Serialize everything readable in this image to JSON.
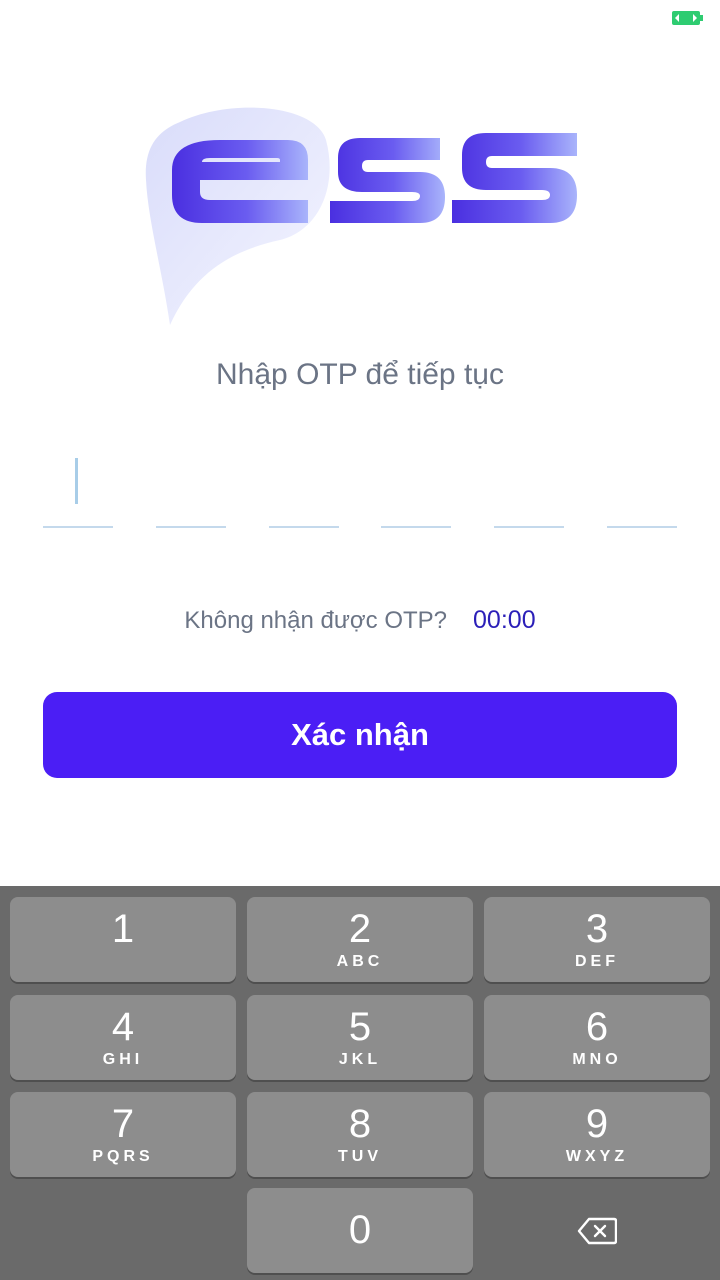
{
  "colors": {
    "accent": "#4b1ef5",
    "timer": "#2b1fb8",
    "muted_text": "#6b7485",
    "keypad_bg": "#6a6a6a",
    "key_bg": "#8d8d8d"
  },
  "status_bar": {
    "icon": "battery-icon"
  },
  "logo": {
    "text": "ess",
    "icon": "ess-logo"
  },
  "otp": {
    "prompt": "Nhập OTP để tiếp tục",
    "digits": [
      "",
      "",
      "",
      "",
      "",
      ""
    ]
  },
  "resend": {
    "question": "Không nhận được OTP?",
    "timer": "00:00"
  },
  "confirm_button": {
    "label": "Xác nhận"
  },
  "keypad": {
    "keys": [
      {
        "num": "1",
        "letters": ""
      },
      {
        "num": "2",
        "letters": "ABC"
      },
      {
        "num": "3",
        "letters": "DEF"
      },
      {
        "num": "4",
        "letters": "GHI"
      },
      {
        "num": "5",
        "letters": "JKL"
      },
      {
        "num": "6",
        "letters": "MNO"
      },
      {
        "num": "7",
        "letters": "PQRS"
      },
      {
        "num": "8",
        "letters": "TUV"
      },
      {
        "num": "9",
        "letters": "WXYZ"
      },
      {
        "num": "0",
        "letters": ""
      }
    ],
    "delete_icon": "backspace-icon"
  }
}
